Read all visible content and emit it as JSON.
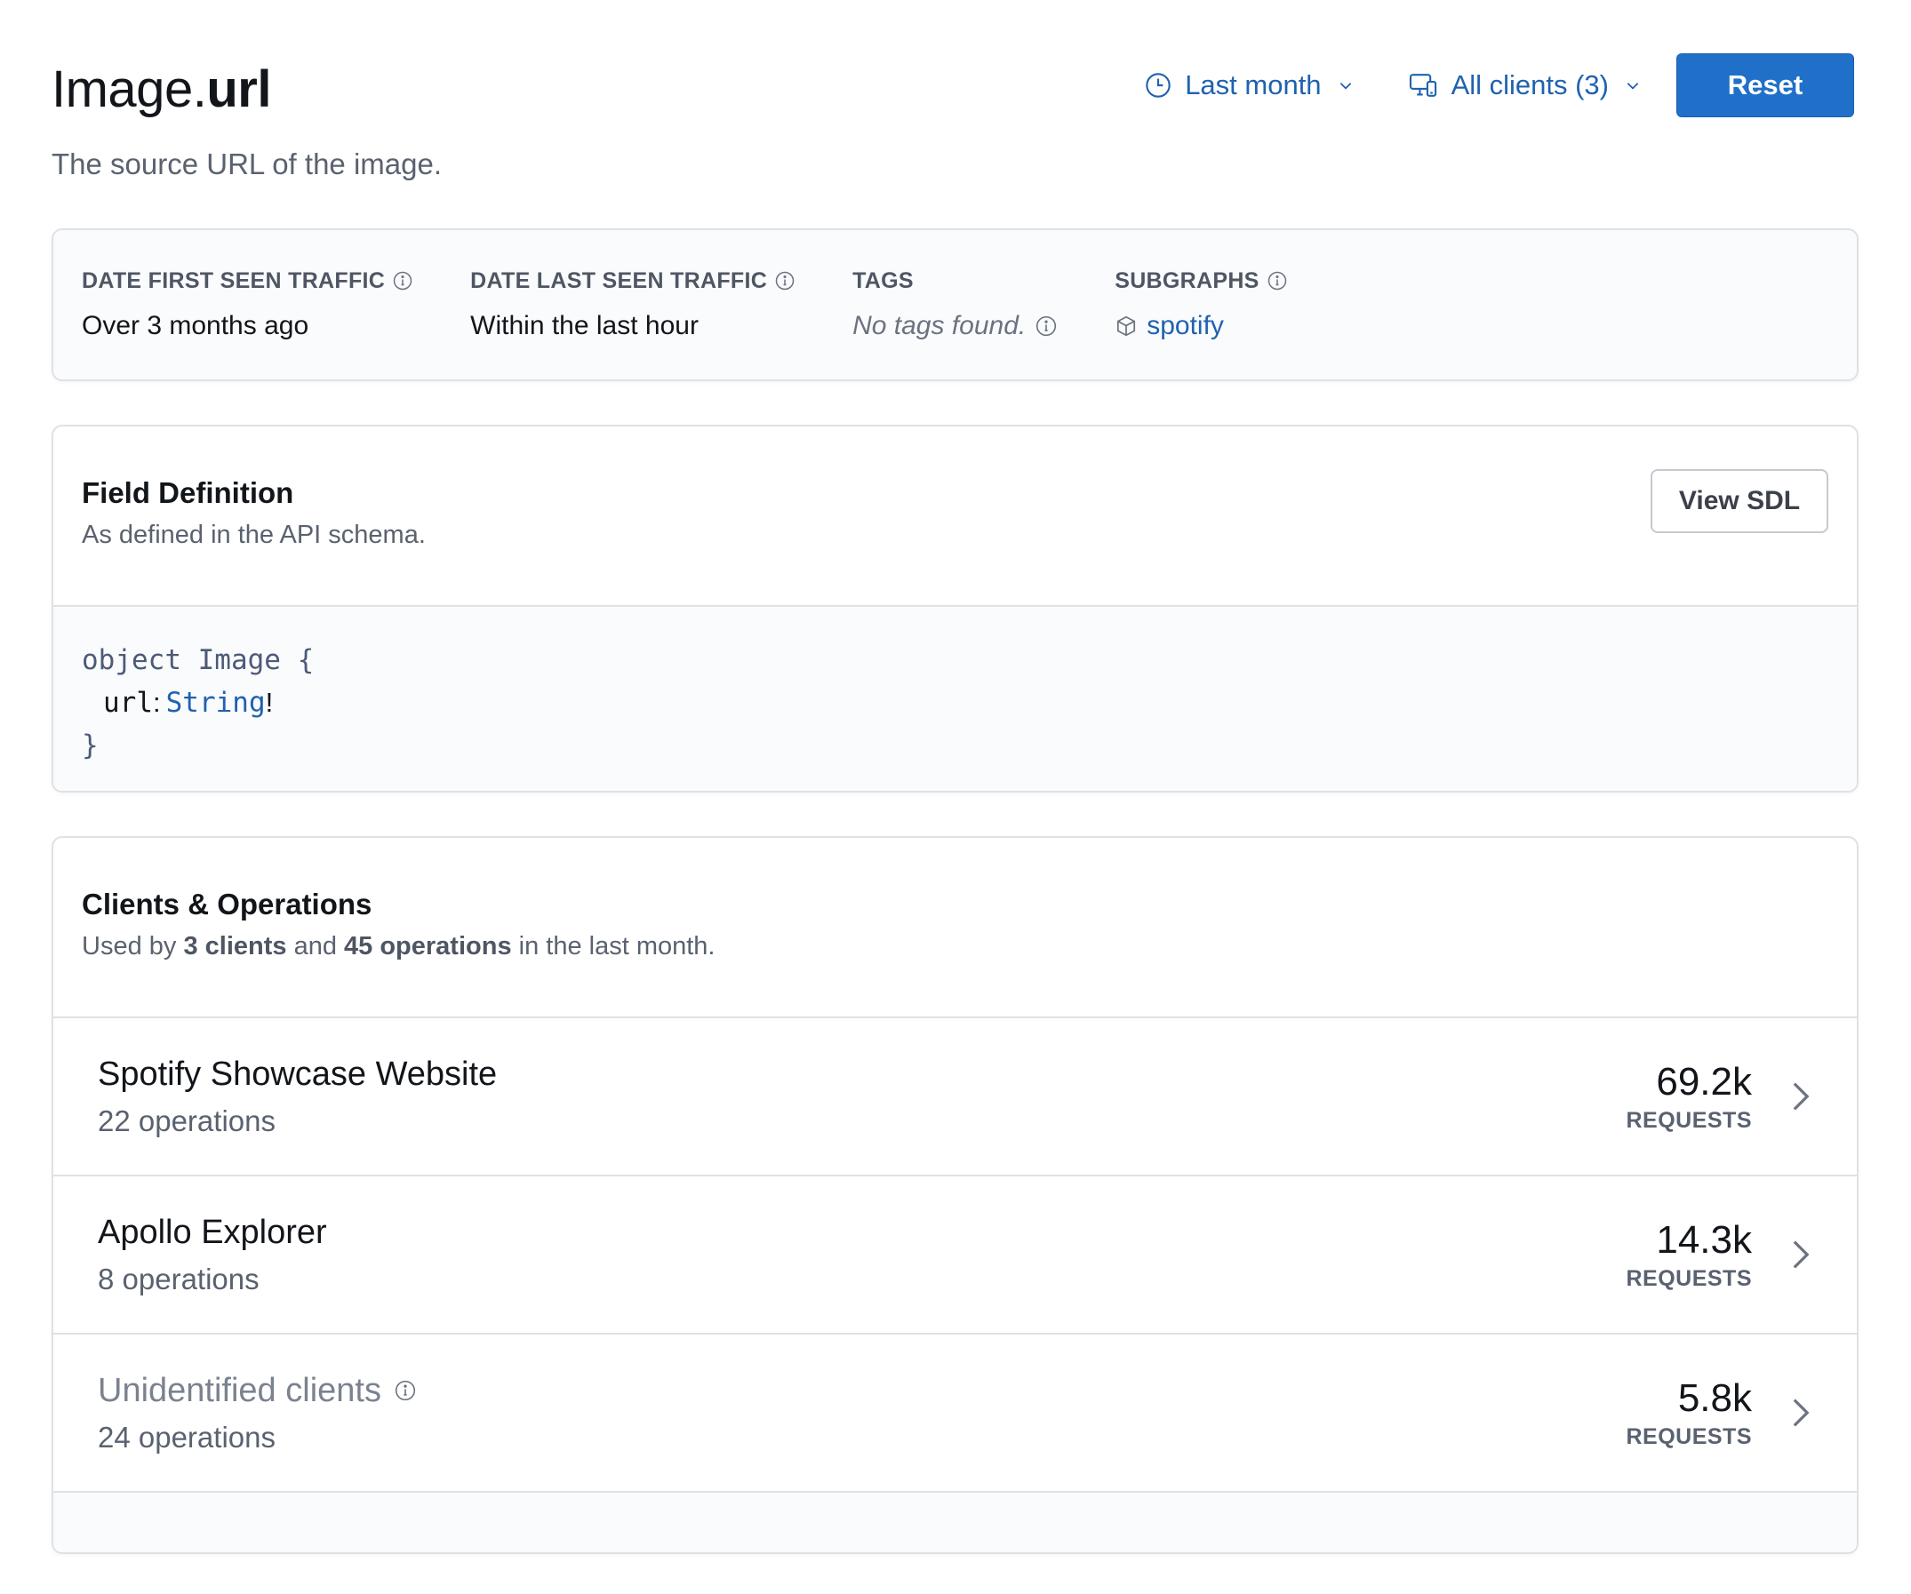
{
  "header": {
    "title_prefix": "Image.",
    "title_field": "url",
    "description": "The source URL of the image."
  },
  "toolbar": {
    "time_range": {
      "label": "Last month",
      "icon": "clock-icon"
    },
    "clients_filter": {
      "label": "All clients (3)",
      "icon": "devices-icon"
    },
    "reset_label": "Reset",
    "accent_color": "#2070c9"
  },
  "metadata": {
    "first_seen": {
      "label": "DATE FIRST SEEN TRAFFIC",
      "value": "Over 3 months ago"
    },
    "last_seen": {
      "label": "DATE LAST SEEN TRAFFIC",
      "value": "Within the last hour"
    },
    "tags": {
      "label": "TAGS",
      "value": "No tags found."
    },
    "subgraphs": {
      "label": "SUBGRAPHS",
      "value": "spotify",
      "icon": "cube-icon"
    }
  },
  "field_definition": {
    "title": "Field Definition",
    "description": "As defined in the API schema.",
    "view_sdl_label": "View SDL",
    "code": {
      "line1": "object Image {",
      "field_name": "url",
      "colon": ":",
      "field_type": "String",
      "bang": "!",
      "closing": "}"
    }
  },
  "clients_operations": {
    "title": "Clients & Operations",
    "desc_prefix": "Used by ",
    "desc_clients": "3 clients",
    "desc_mid": " and ",
    "desc_ops": "45 operations",
    "desc_suffix": " in the last month.",
    "rows": [
      {
        "name": "Spotify Showcase Website",
        "operations": "22 operations",
        "requests": "69.2k",
        "unit": "REQUESTS"
      },
      {
        "name": "Apollo Explorer",
        "operations": "8 operations",
        "requests": "14.3k",
        "unit": "REQUESTS"
      },
      {
        "name": "Unidentified clients",
        "operations": "24 operations",
        "requests": "5.8k",
        "unit": "REQUESTS"
      }
    ]
  }
}
